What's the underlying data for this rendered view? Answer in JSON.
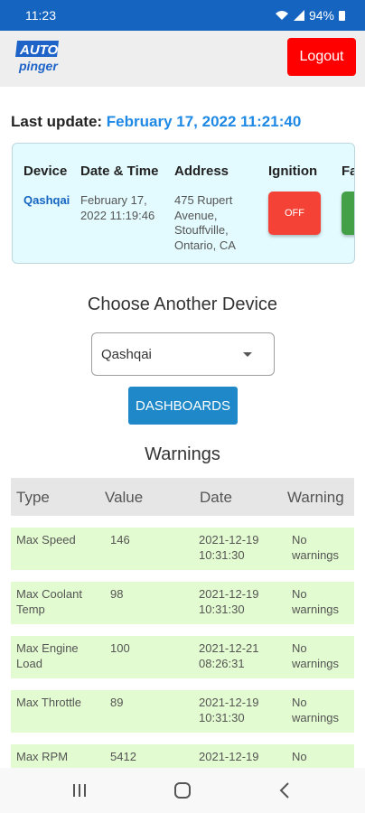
{
  "status_bar": {
    "time": "11:23",
    "battery": "94%"
  },
  "header": {
    "logo_top": "AUTO",
    "logo_bottom": "pinger",
    "logout_label": "Logout"
  },
  "last_update": {
    "label": "Last update:",
    "value": "February 17, 2022 11:21:40"
  },
  "device_card": {
    "headers": [
      "Device",
      "Date & Time",
      "Address",
      "Ignition",
      "Fa"
    ],
    "device": "Qashqai",
    "datetime_line1": "February 17,",
    "datetime_line2": "2022 11:19:46",
    "address_lines": [
      "475 Rupert",
      "Avenue,",
      "Stouffville,",
      "Ontario, CA"
    ],
    "ignition_label": "OFF"
  },
  "chooser": {
    "title": "Choose Another Device",
    "selected": "Qashqai",
    "dashboards_label": "DASHBOARDS"
  },
  "warnings": {
    "title": "Warnings",
    "columns": [
      "Type",
      "Value",
      "Date",
      "Warning"
    ],
    "rows": [
      {
        "type_l1": "Max Speed",
        "type_l2": "",
        "value": "146",
        "date_l1": "2021-12-19",
        "date_l2": "10:31:30",
        "warn_l1": "No",
        "warn_l2": "warnings"
      },
      {
        "type_l1": "Max Coolant",
        "type_l2": "Temp",
        "value": "98",
        "date_l1": "2021-12-19",
        "date_l2": "10:31:30",
        "warn_l1": "No",
        "warn_l2": "warnings"
      },
      {
        "type_l1": "Max Engine",
        "type_l2": "Load",
        "value": "100",
        "date_l1": "2021-12-21",
        "date_l2": "08:26:31",
        "warn_l1": "No",
        "warn_l2": "warnings"
      },
      {
        "type_l1": "Max Throttle",
        "type_l2": "",
        "value": "89",
        "date_l1": "2021-12-19",
        "date_l2": "10:31:30",
        "warn_l1": "No",
        "warn_l2": "warnings"
      },
      {
        "type_l1": "Max RPM",
        "type_l2": "",
        "value": "5412",
        "date_l1": "2021-12-19",
        "date_l2": "",
        "warn_l1": "No",
        "warn_l2": ""
      }
    ]
  },
  "colors": {
    "status_bar": "#1565c0",
    "logout": "#ff0000",
    "accent": "#1e88e5",
    "ignition_off": "#f44336",
    "warning_row": "#e2fbd0",
    "card_bg": "#e3fbff"
  }
}
